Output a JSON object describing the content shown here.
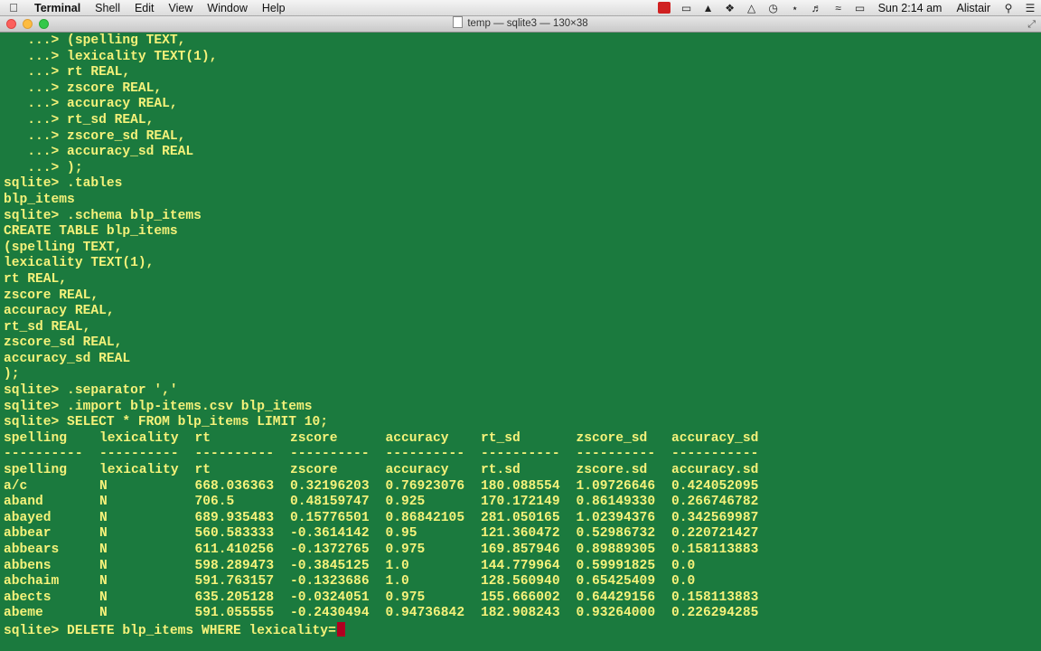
{
  "menubar": {
    "app": "Terminal",
    "menus": [
      "Shell",
      "Edit",
      "View",
      "Window",
      "Help"
    ],
    "clock": "Sun 2:14 am",
    "user": "Alistair"
  },
  "window": {
    "title": "temp — sqlite3 — 130×38"
  },
  "terminal": {
    "lines": [
      "   ...> (spelling TEXT,",
      "   ...> lexicality TEXT(1),",
      "   ...> rt REAL,",
      "   ...> zscore REAL,",
      "   ...> accuracy REAL,",
      "   ...> rt_sd REAL,",
      "   ...> zscore_sd REAL,",
      "   ...> accuracy_sd REAL",
      "   ...> );",
      "sqlite> .tables",
      "blp_items",
      "sqlite> .schema blp_items",
      "CREATE TABLE blp_items",
      "(spelling TEXT,",
      "lexicality TEXT(1),",
      "rt REAL,",
      "zscore REAL,",
      "accuracy REAL,",
      "rt_sd REAL,",
      "zscore_sd REAL,",
      "accuracy_sd REAL",
      ");",
      "sqlite> .separator ',' ",
      "sqlite> .import blp-items.csv blp_items",
      "sqlite> SELECT * FROM blp_items LIMIT 10;"
    ],
    "table": {
      "headers": [
        "spelling",
        "lexicality",
        "rt",
        "zscore",
        "accuracy",
        "rt_sd",
        "zscore_sd",
        "accuracy_sd"
      ],
      "dividers": [
        "----------",
        "----------",
        "----------",
        "----------",
        "----------",
        "----------",
        "----------",
        "-----------"
      ],
      "rows": [
        [
          "spelling",
          "lexicality",
          "rt",
          "zscore",
          "accuracy",
          "rt.sd",
          "zscore.sd",
          "accuracy.sd"
        ],
        [
          "a/c",
          "N",
          "668.036363",
          "0.32196203",
          "0.76923076",
          "180.088554",
          "1.09726646",
          "0.424052095"
        ],
        [
          "aband",
          "N",
          "706.5",
          "0.48159747",
          "0.925",
          "170.172149",
          "0.86149330",
          "0.266746782"
        ],
        [
          "abayed",
          "N",
          "689.935483",
          "0.15776501",
          "0.86842105",
          "281.050165",
          "1.02394376",
          "0.342569987"
        ],
        [
          "abbear",
          "N",
          "560.583333",
          "-0.3614142",
          "0.95",
          "121.360472",
          "0.52986732",
          "0.220721427"
        ],
        [
          "abbears",
          "N",
          "611.410256",
          "-0.1372765",
          "0.975",
          "169.857946",
          "0.89889305",
          "0.158113883"
        ],
        [
          "abbens",
          "N",
          "598.289473",
          "-0.3845125",
          "1.0",
          "144.779964",
          "0.59991825",
          "0.0"
        ],
        [
          "abchaim",
          "N",
          "591.763157",
          "-0.1323686",
          "1.0",
          "128.560940",
          "0.65425409",
          "0.0"
        ],
        [
          "abects",
          "N",
          "635.205128",
          "-0.0324051",
          "0.975",
          "155.666002",
          "0.64429156",
          "0.158113883"
        ],
        [
          "abeme",
          "N",
          "591.055555",
          "-0.2430494",
          "0.94736842",
          "182.908243",
          "0.93264000",
          "0.226294285"
        ]
      ]
    },
    "prompt": "sqlite> DELETE blp_items WHERE lexicality="
  },
  "colors": {
    "background": "#1b7a3e",
    "text": "#f5f27a",
    "cursor": "#b00020"
  }
}
